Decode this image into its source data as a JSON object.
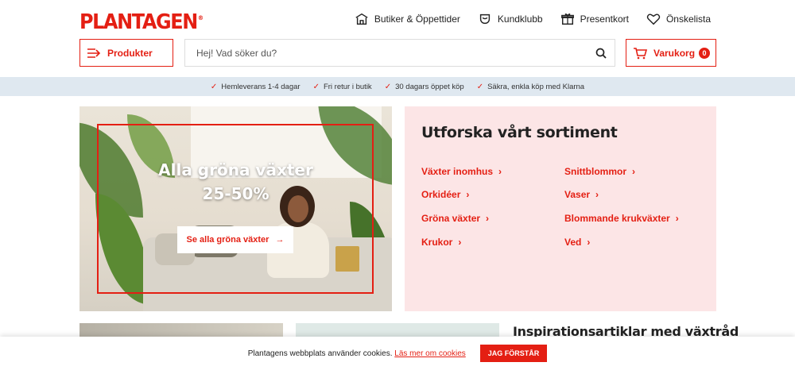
{
  "header": {
    "logo": "PLANTAGEN",
    "logo_mark": "®",
    "links": [
      {
        "label": "Butiker & Öppettider",
        "icon": "store-icon"
      },
      {
        "label": "Kundklubb",
        "icon": "cup-icon"
      },
      {
        "label": "Presentkort",
        "icon": "gift-icon"
      },
      {
        "label": "Önskelista",
        "icon": "heart-icon"
      }
    ],
    "products_label": "Produkter",
    "search_placeholder": "Hej! Vad söker du?",
    "cart_label": "Varukorg",
    "cart_count": "0"
  },
  "usp": [
    "Hemleverans 1-4 dagar",
    "Fri retur i butik",
    "30 dagars öppet köp",
    "Säkra, enkla köp med Klarna"
  ],
  "hero": {
    "title_line1": "Alla gröna växter",
    "title_line2": "25-50%",
    "button_label": "Se alla gröna växter"
  },
  "explore": {
    "title": "Utforska vårt sortiment",
    "left": [
      "Växter inomhus",
      "Orkidéer",
      "Gröna växter",
      "Krukor"
    ],
    "right": [
      "Snittblommor",
      "Vaser",
      "Blommande krukväxter",
      "Ved"
    ]
  },
  "inspiration_title": "Inspirationsartiklar med växtråd",
  "cookie": {
    "text": "Plantagens webbplats använder cookies.",
    "link": "Läs mer om cookies",
    "button": "JAG FÖRSTÅR"
  },
  "colors": {
    "brand": "#e41f13",
    "usp_bg": "#dfe8f0",
    "explore_bg": "#fce5e6"
  }
}
